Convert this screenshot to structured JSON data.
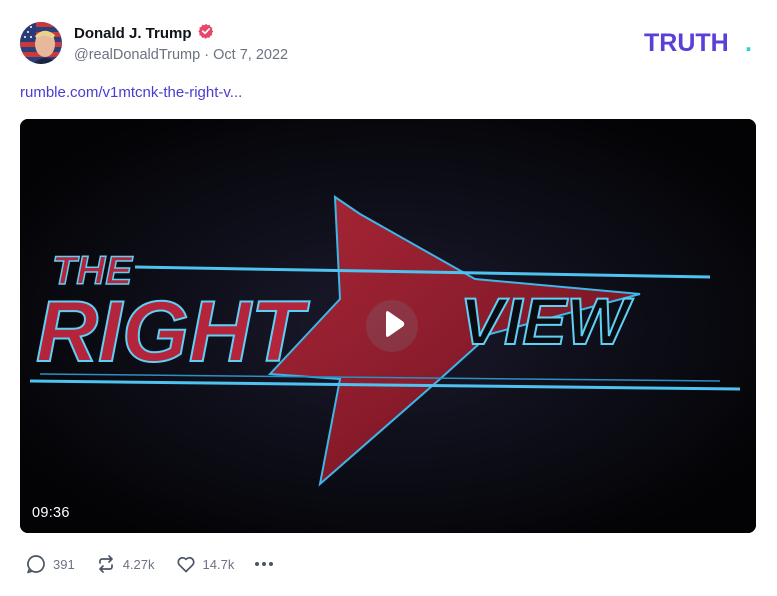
{
  "post": {
    "author_name": "Donald J. Trump",
    "handle": "@realDonaldTrump",
    "separator": "·",
    "date": "Oct 7, 2022",
    "verified_icon": "verified-badge-icon",
    "link_text": "rumble.com/v1mtcnk-the-right-v..."
  },
  "brand": {
    "logo_text": "TRUTH",
    "logo_dot": ".",
    "logo_color": "#5b3fd6",
    "logo_dot_color": "#2dd4c4"
  },
  "video": {
    "duration": "09:36",
    "thumbnail_title": "THE RIGHT VIEW",
    "thumb_word_the": "THE",
    "thumb_word_right": "RIGHT",
    "thumb_word_view": "VIEW",
    "play_icon": "play-icon"
  },
  "actions": {
    "replies": "391",
    "retruths": "4.27k",
    "likes": "14.7k",
    "reply_icon": "comment-icon",
    "retruth_icon": "retruth-icon",
    "like_icon": "heart-icon",
    "more_icon": "more-icon"
  },
  "colors": {
    "accent": "#4b3ccf",
    "muted": "#6b7280",
    "verified": "#e8466a"
  }
}
